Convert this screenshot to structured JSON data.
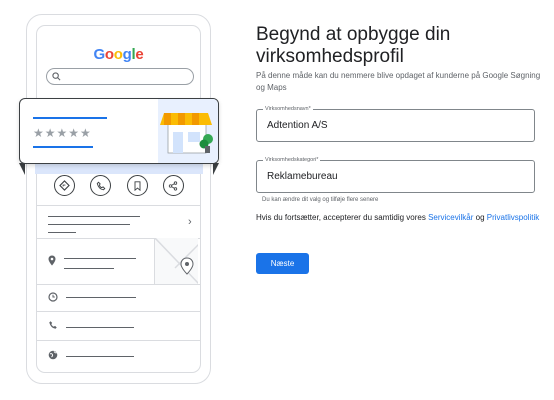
{
  "illustration": {
    "logo_text": "Google",
    "logo_colors": [
      "#4285F4",
      "#EA4335",
      "#FBBC05",
      "#4285F4",
      "#34A853",
      "#EA4335"
    ],
    "rating_stars": "★★★★★",
    "chevron": "›"
  },
  "form": {
    "heading": "Begynd at opbygge din virksomhedsprofil",
    "intro": "På denne måde kan du nemmere blive opdaget af kunderne på Google Søgning og Maps",
    "business_name": {
      "label": "Virksomhedsnavn*",
      "value": "Adtention A/S"
    },
    "business_category": {
      "label": "Virksomhedskategori*",
      "value": "Reklamebureau",
      "hint": "Du kan ændre dit valg og tilføje flere senere"
    },
    "consent": {
      "prefix": "Hvis du fortsætter, accepterer du samtidig vores ",
      "terms_link": "Servicevilkår",
      "middle": " og ",
      "privacy_link": "Privatlivspolitik"
    },
    "next_button": "Næste"
  },
  "colors": {
    "accent": "#1a73e8",
    "text": "#202124",
    "muted": "#5f6368"
  }
}
